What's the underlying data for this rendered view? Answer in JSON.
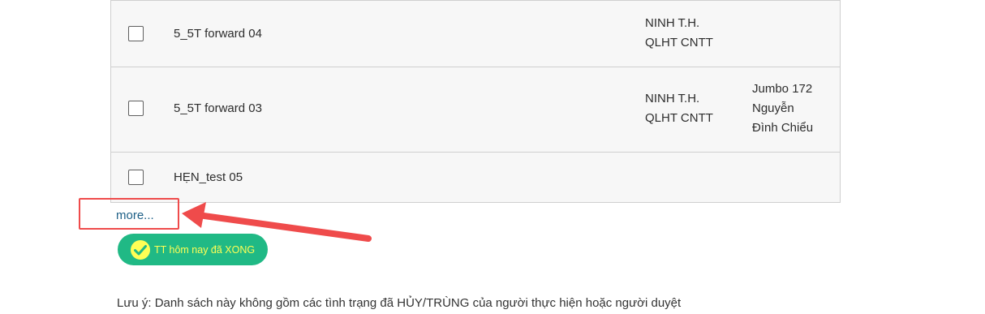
{
  "table": {
    "rows": [
      {
        "title": "5_5T forward 04",
        "person_line1": "NINH T.H.",
        "person_line2": "QLHT CNTT",
        "place_line1": "",
        "place_line2": "",
        "place_line3": ""
      },
      {
        "title": "5_5T forward 03",
        "person_line1": "NINH T.H.",
        "person_line2": "QLHT CNTT",
        "place_line1": "Jumbo 172",
        "place_line2": "Nguyễn",
        "place_line3": "Đình Chiểu"
      },
      {
        "title": "HẸN_test 05",
        "person_line1": "",
        "person_line2": "",
        "place_line1": "",
        "place_line2": "",
        "place_line3": ""
      }
    ]
  },
  "more_link": "more...",
  "done_button": {
    "label": "TT hôm nay đã XONG",
    "icon": "check-circle-icon"
  },
  "note": "Lưu ý: Danh sách này không gồm các tình trạng đã HỦY/TRÙNG của người thực hiện hoặc người duyệt",
  "colors": {
    "annotation_red": "#ef4b4b",
    "button_green": "#20b985",
    "button_text_yellow": "#ffff55",
    "link_blue": "#1d5f86"
  }
}
